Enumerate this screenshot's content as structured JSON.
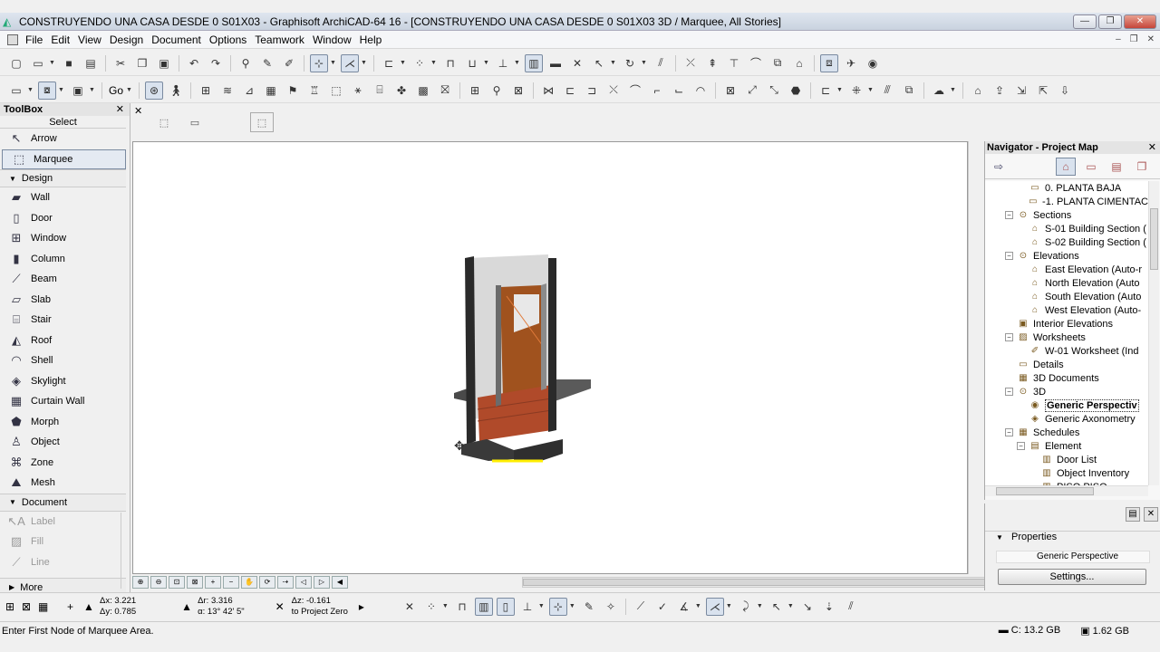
{
  "window": {
    "title": "CONSTRUYENDO UNA CASA DESDE 0 S01X03 - Graphisoft ArchiCAD-64 16 - [CONSTRUYENDO UNA CASA DESDE 0 S01X03 3D / Marquee, All Stories]",
    "minimize": "—",
    "maximize": "❐",
    "close": "✕"
  },
  "menu": {
    "items": [
      "File",
      "Edit",
      "View",
      "Design",
      "Document",
      "Options",
      "Teamwork",
      "Window",
      "Help"
    ],
    "doc_controls": [
      "–",
      "❐",
      "✕"
    ]
  },
  "toolbar2": {
    "go_label": "Go"
  },
  "toolbox": {
    "title": "ToolBox",
    "select_label": "Select",
    "top_items": [
      {
        "label": "Arrow",
        "icon": "arrow-icon"
      },
      {
        "label": "Marquee",
        "icon": "marquee-icon",
        "selected": true
      }
    ],
    "design_label": "Design",
    "design_items": [
      {
        "label": "Wall",
        "icon": "wall-icon"
      },
      {
        "label": "Door",
        "icon": "door-icon"
      },
      {
        "label": "Window",
        "icon": "window-icon"
      },
      {
        "label": "Column",
        "icon": "column-icon"
      },
      {
        "label": "Beam",
        "icon": "beam-icon"
      },
      {
        "label": "Slab",
        "icon": "slab-icon"
      },
      {
        "label": "Stair",
        "icon": "stair-icon"
      },
      {
        "label": "Roof",
        "icon": "roof-icon"
      },
      {
        "label": "Shell",
        "icon": "shell-icon"
      },
      {
        "label": "Skylight",
        "icon": "skylight-icon"
      },
      {
        "label": "Curtain Wall",
        "icon": "curtain-wall-icon"
      },
      {
        "label": "Morph",
        "icon": "morph-icon"
      },
      {
        "label": "Object",
        "icon": "object-icon"
      },
      {
        "label": "Zone",
        "icon": "zone-icon"
      },
      {
        "label": "Mesh",
        "icon": "mesh-icon"
      }
    ],
    "document_label": "Document",
    "document_items": [
      {
        "label": "Label",
        "icon": "label-icon"
      },
      {
        "label": "Fill",
        "icon": "fill-icon"
      },
      {
        "label": "Line",
        "icon": "line-icon"
      }
    ],
    "more_label": "More"
  },
  "navigator": {
    "title": "Navigator - Project Map",
    "tree": [
      {
        "indent": 3,
        "label": "0. PLANTA BAJA",
        "icon": "story-icon"
      },
      {
        "indent": 3,
        "label": "-1. PLANTA CIMENTAC",
        "icon": "story-icon"
      },
      {
        "indent": 2,
        "label": "Sections",
        "icon": "sections-icon",
        "expander": "−"
      },
      {
        "indent": 3,
        "label": "S-01 Building Section (",
        "icon": "section-view-icon"
      },
      {
        "indent": 3,
        "label": "S-02 Building Section (",
        "icon": "section-view-icon"
      },
      {
        "indent": 2,
        "label": "Elevations",
        "icon": "elevations-icon",
        "expander": "−"
      },
      {
        "indent": 3,
        "label": "East Elevation (Auto-r",
        "icon": "elevation-view-icon"
      },
      {
        "indent": 3,
        "label": "North Elevation (Auto",
        "icon": "elevation-view-icon"
      },
      {
        "indent": 3,
        "label": "South Elevation (Auto",
        "icon": "elevation-view-icon"
      },
      {
        "indent": 3,
        "label": "West Elevation (Auto-",
        "icon": "elevation-view-icon"
      },
      {
        "indent": 2,
        "label": "Interior Elevations",
        "icon": "interior-elevations-icon"
      },
      {
        "indent": 2,
        "label": "Worksheets",
        "icon": "worksheets-icon",
        "expander": "−"
      },
      {
        "indent": 3,
        "label": "W-01 Worksheet (Ind",
        "icon": "worksheet-icon"
      },
      {
        "indent": 2,
        "label": "Details",
        "icon": "details-icon"
      },
      {
        "indent": 2,
        "label": "3D Documents",
        "icon": "3d-documents-icon"
      },
      {
        "indent": 2,
        "label": "3D",
        "icon": "3d-icon",
        "expander": "−"
      },
      {
        "indent": 3,
        "label": "Generic Perspectiv",
        "icon": "perspective-icon",
        "selected": true
      },
      {
        "indent": 3,
        "label": "Generic Axonometry",
        "icon": "axonometry-icon"
      },
      {
        "indent": 2,
        "label": "Schedules",
        "icon": "schedules-icon",
        "expander": "−"
      },
      {
        "indent": 3,
        "label": "Element",
        "icon": "element-icon",
        "expander": "−"
      },
      {
        "indent": 4,
        "label": "Door List",
        "icon": "list-icon"
      },
      {
        "indent": 4,
        "label": "Object Inventory",
        "icon": "list-icon"
      },
      {
        "indent": 4,
        "label": "PISO PISO",
        "icon": "list-icon"
      }
    ]
  },
  "properties": {
    "title": "Properties",
    "value": "Generic Perspective",
    "settings_button": "Settings..."
  },
  "coordinates": {
    "dx": "Δx: 3.221",
    "dy": "Δy: 0.785",
    "dr": "Δr: 3.316",
    "angle": "α: 13° 42' 5\"",
    "dz": "Δz: -0.161",
    "reference": "to Project Zero"
  },
  "status": {
    "message": "Enter First Node of Marquee Area.",
    "disk": "C: 13.2 GB",
    "memory": "1.62 GB"
  },
  "colors": {
    "selection_blue": "#d9e2ee",
    "viewport_bg": "#ffffff",
    "brick": "#b04a2a",
    "wood": "#a0521e",
    "highlight_yellow": "#ffee00"
  }
}
